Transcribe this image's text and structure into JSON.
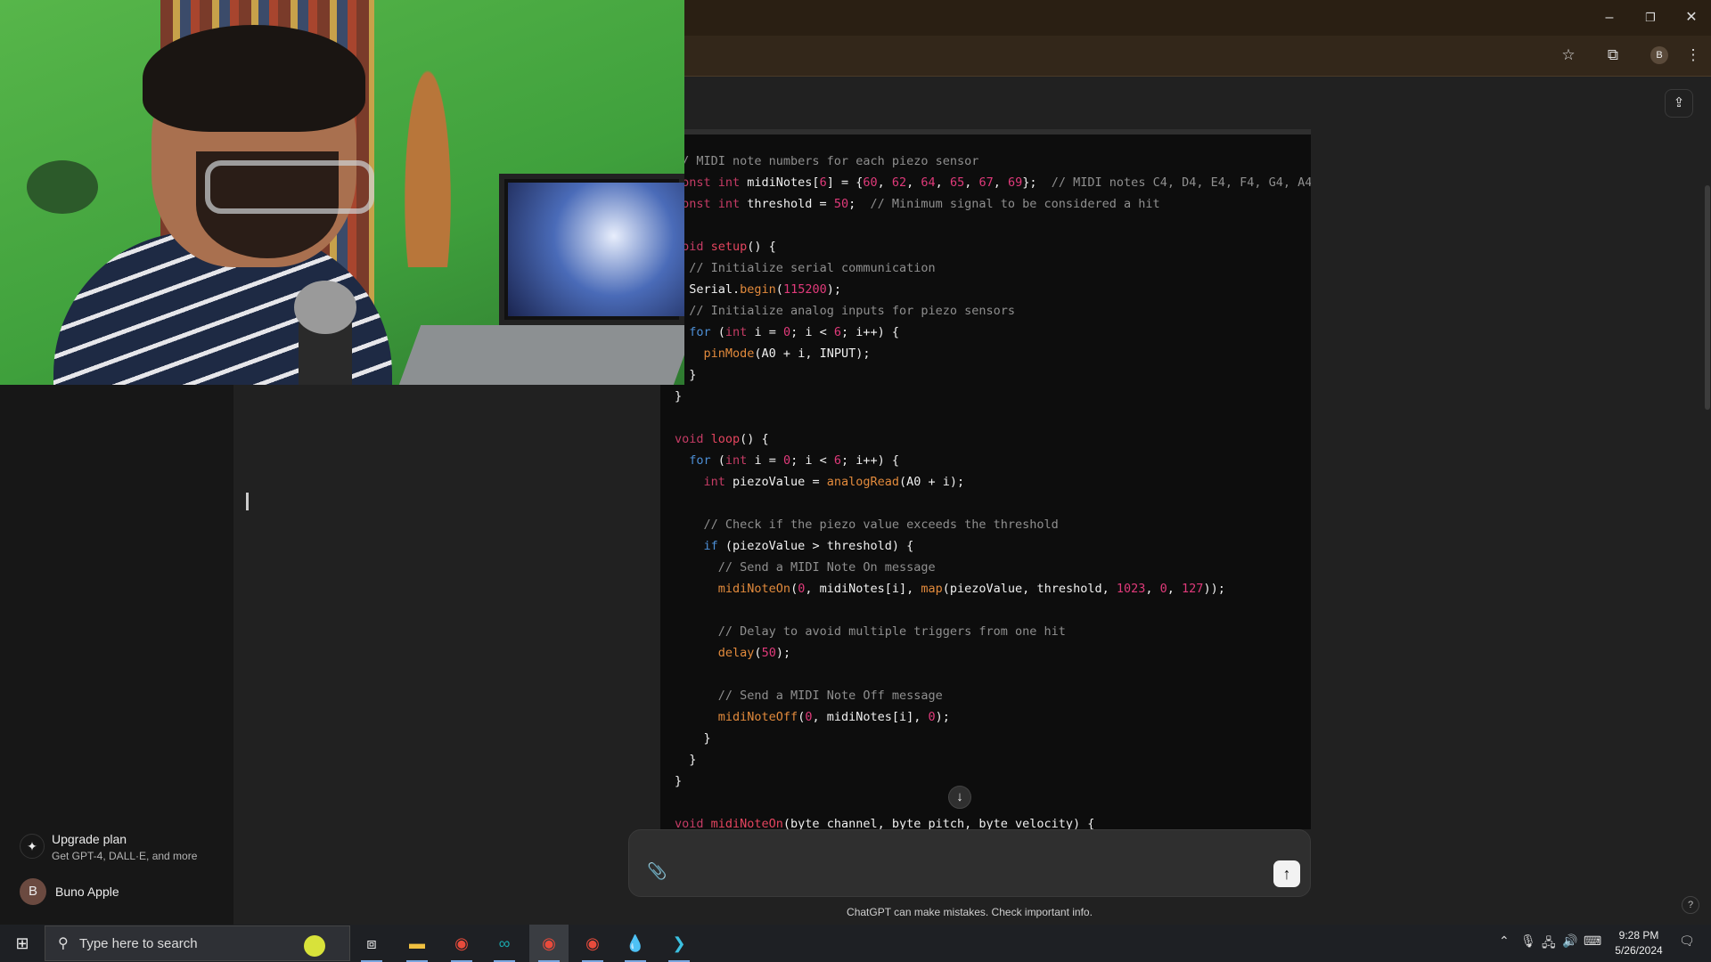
{
  "window": {
    "minimize": "–",
    "restore": "❐",
    "close": "✕"
  },
  "toolbar": {
    "bookmark_icon": "star-icon",
    "extensions_icon": "puzzle-icon",
    "profile_initial": "B",
    "menu_icon": "kebab-icon"
  },
  "sidebar": {
    "upgrade": {
      "title": "Upgrade plan",
      "subtitle": "Get GPT-4, DALL·E, and more"
    },
    "user": {
      "initial": "B",
      "name": "Buno Apple"
    }
  },
  "code": {
    "lines": [
      [
        [
          "c",
          "// MIDI note numbers for each piezo sensor"
        ]
      ],
      [
        [
          "k",
          "const int "
        ],
        [
          "p",
          "midiNotes["
        ],
        [
          "n",
          "6"
        ],
        [
          "p",
          "] = {"
        ],
        [
          "n",
          "60"
        ],
        [
          "p",
          ", "
        ],
        [
          "n",
          "62"
        ],
        [
          "p",
          ", "
        ],
        [
          "n",
          "64"
        ],
        [
          "p",
          ", "
        ],
        [
          "n",
          "65"
        ],
        [
          "p",
          ", "
        ],
        [
          "n",
          "67"
        ],
        [
          "p",
          ", "
        ],
        [
          "n",
          "69"
        ],
        [
          "p",
          "};  "
        ],
        [
          "c",
          "// MIDI notes C4, D4, E4, F4, G4, A4"
        ]
      ],
      [
        [
          "k",
          "const int "
        ],
        [
          "p",
          "threshold = "
        ],
        [
          "n",
          "50"
        ],
        [
          "p",
          ";  "
        ],
        [
          "c",
          "// Minimum signal to be considered a hit"
        ]
      ],
      [],
      [
        [
          "k",
          "void "
        ],
        [
          "f",
          "setup"
        ],
        [
          "p",
          "() {"
        ]
      ],
      [
        [
          "p",
          "  "
        ],
        [
          "c",
          "// Initialize serial communication"
        ]
      ],
      [
        [
          "p",
          "  Serial."
        ],
        [
          "b",
          "begin"
        ],
        [
          "p",
          "("
        ],
        [
          "n",
          "115200"
        ],
        [
          "p",
          ");"
        ]
      ],
      [
        [
          "p",
          "  "
        ],
        [
          "c",
          "// Initialize analog inputs for piezo sensors"
        ]
      ],
      [
        [
          "p",
          "  "
        ],
        [
          "bl",
          "for"
        ],
        [
          "p",
          " ("
        ],
        [
          "k",
          "int"
        ],
        [
          "p",
          " i = "
        ],
        [
          "n",
          "0"
        ],
        [
          "p",
          "; i < "
        ],
        [
          "n",
          "6"
        ],
        [
          "p",
          "; i++) {"
        ]
      ],
      [
        [
          "p",
          "    "
        ],
        [
          "b",
          "pinMode"
        ],
        [
          "p",
          "(A0 + i, INPUT);"
        ]
      ],
      [
        [
          "p",
          "  }"
        ]
      ],
      [
        [
          "p",
          "}"
        ]
      ],
      [],
      [
        [
          "k",
          "void "
        ],
        [
          "f",
          "loop"
        ],
        [
          "p",
          "() {"
        ]
      ],
      [
        [
          "p",
          "  "
        ],
        [
          "bl",
          "for"
        ],
        [
          "p",
          " ("
        ],
        [
          "k",
          "int"
        ],
        [
          "p",
          " i = "
        ],
        [
          "n",
          "0"
        ],
        [
          "p",
          "; i < "
        ],
        [
          "n",
          "6"
        ],
        [
          "p",
          "; i++) {"
        ]
      ],
      [
        [
          "p",
          "    "
        ],
        [
          "k",
          "int"
        ],
        [
          "p",
          " piezoValue = "
        ],
        [
          "b",
          "analogRead"
        ],
        [
          "p",
          "(A0 + i);"
        ]
      ],
      [],
      [
        [
          "p",
          "    "
        ],
        [
          "c",
          "// Check if the piezo value exceeds the threshold"
        ]
      ],
      [
        [
          "p",
          "    "
        ],
        [
          "bl",
          "if"
        ],
        [
          "p",
          " (piezoValue > threshold) {"
        ]
      ],
      [
        [
          "p",
          "      "
        ],
        [
          "c",
          "// Send a MIDI Note On message"
        ]
      ],
      [
        [
          "p",
          "      "
        ],
        [
          "b",
          "midiNoteOn"
        ],
        [
          "p",
          "("
        ],
        [
          "n",
          "0"
        ],
        [
          "p",
          ", midiNotes[i], "
        ],
        [
          "b",
          "map"
        ],
        [
          "p",
          "(piezoValue, threshold, "
        ],
        [
          "n",
          "1023"
        ],
        [
          "p",
          ", "
        ],
        [
          "n",
          "0"
        ],
        [
          "p",
          ", "
        ],
        [
          "n",
          "127"
        ],
        [
          "p",
          "));"
        ]
      ],
      [],
      [
        [
          "p",
          "      "
        ],
        [
          "c",
          "// Delay to avoid multiple triggers from one hit"
        ]
      ],
      [
        [
          "p",
          "      "
        ],
        [
          "b",
          "delay"
        ],
        [
          "p",
          "("
        ],
        [
          "n",
          "50"
        ],
        [
          "p",
          ");"
        ]
      ],
      [],
      [
        [
          "p",
          "      "
        ],
        [
          "c",
          "// Send a MIDI Note Off message"
        ]
      ],
      [
        [
          "p",
          "      "
        ],
        [
          "b",
          "midiNoteOff"
        ],
        [
          "p",
          "("
        ],
        [
          "n",
          "0"
        ],
        [
          "p",
          ", midiNotes[i], "
        ],
        [
          "n",
          "0"
        ],
        [
          "p",
          ");"
        ]
      ],
      [
        [
          "p",
          "    }"
        ]
      ],
      [
        [
          "p",
          "  }"
        ]
      ],
      [
        [
          "p",
          "}"
        ]
      ],
      [],
      [
        [
          "k",
          "void "
        ],
        [
          "f",
          "midiNoteOn"
        ],
        [
          "p",
          "(byte channel, byte pitch, byte velocity) {"
        ]
      ]
    ]
  },
  "chat": {
    "scroll_down": "↓",
    "attach": "📎",
    "send": "↑",
    "share": "⇪",
    "help": "?",
    "disclaimer": "ChatGPT can make mistakes. Check important info."
  },
  "taskbar": {
    "search_placeholder": "Type here to search",
    "apps": [
      "task-view",
      "file-explorer",
      "chrome",
      "arduino",
      "chrome",
      "chrome",
      "drop-app",
      "terminal"
    ],
    "time": "9:28 PM",
    "date": "5/26/2024"
  }
}
